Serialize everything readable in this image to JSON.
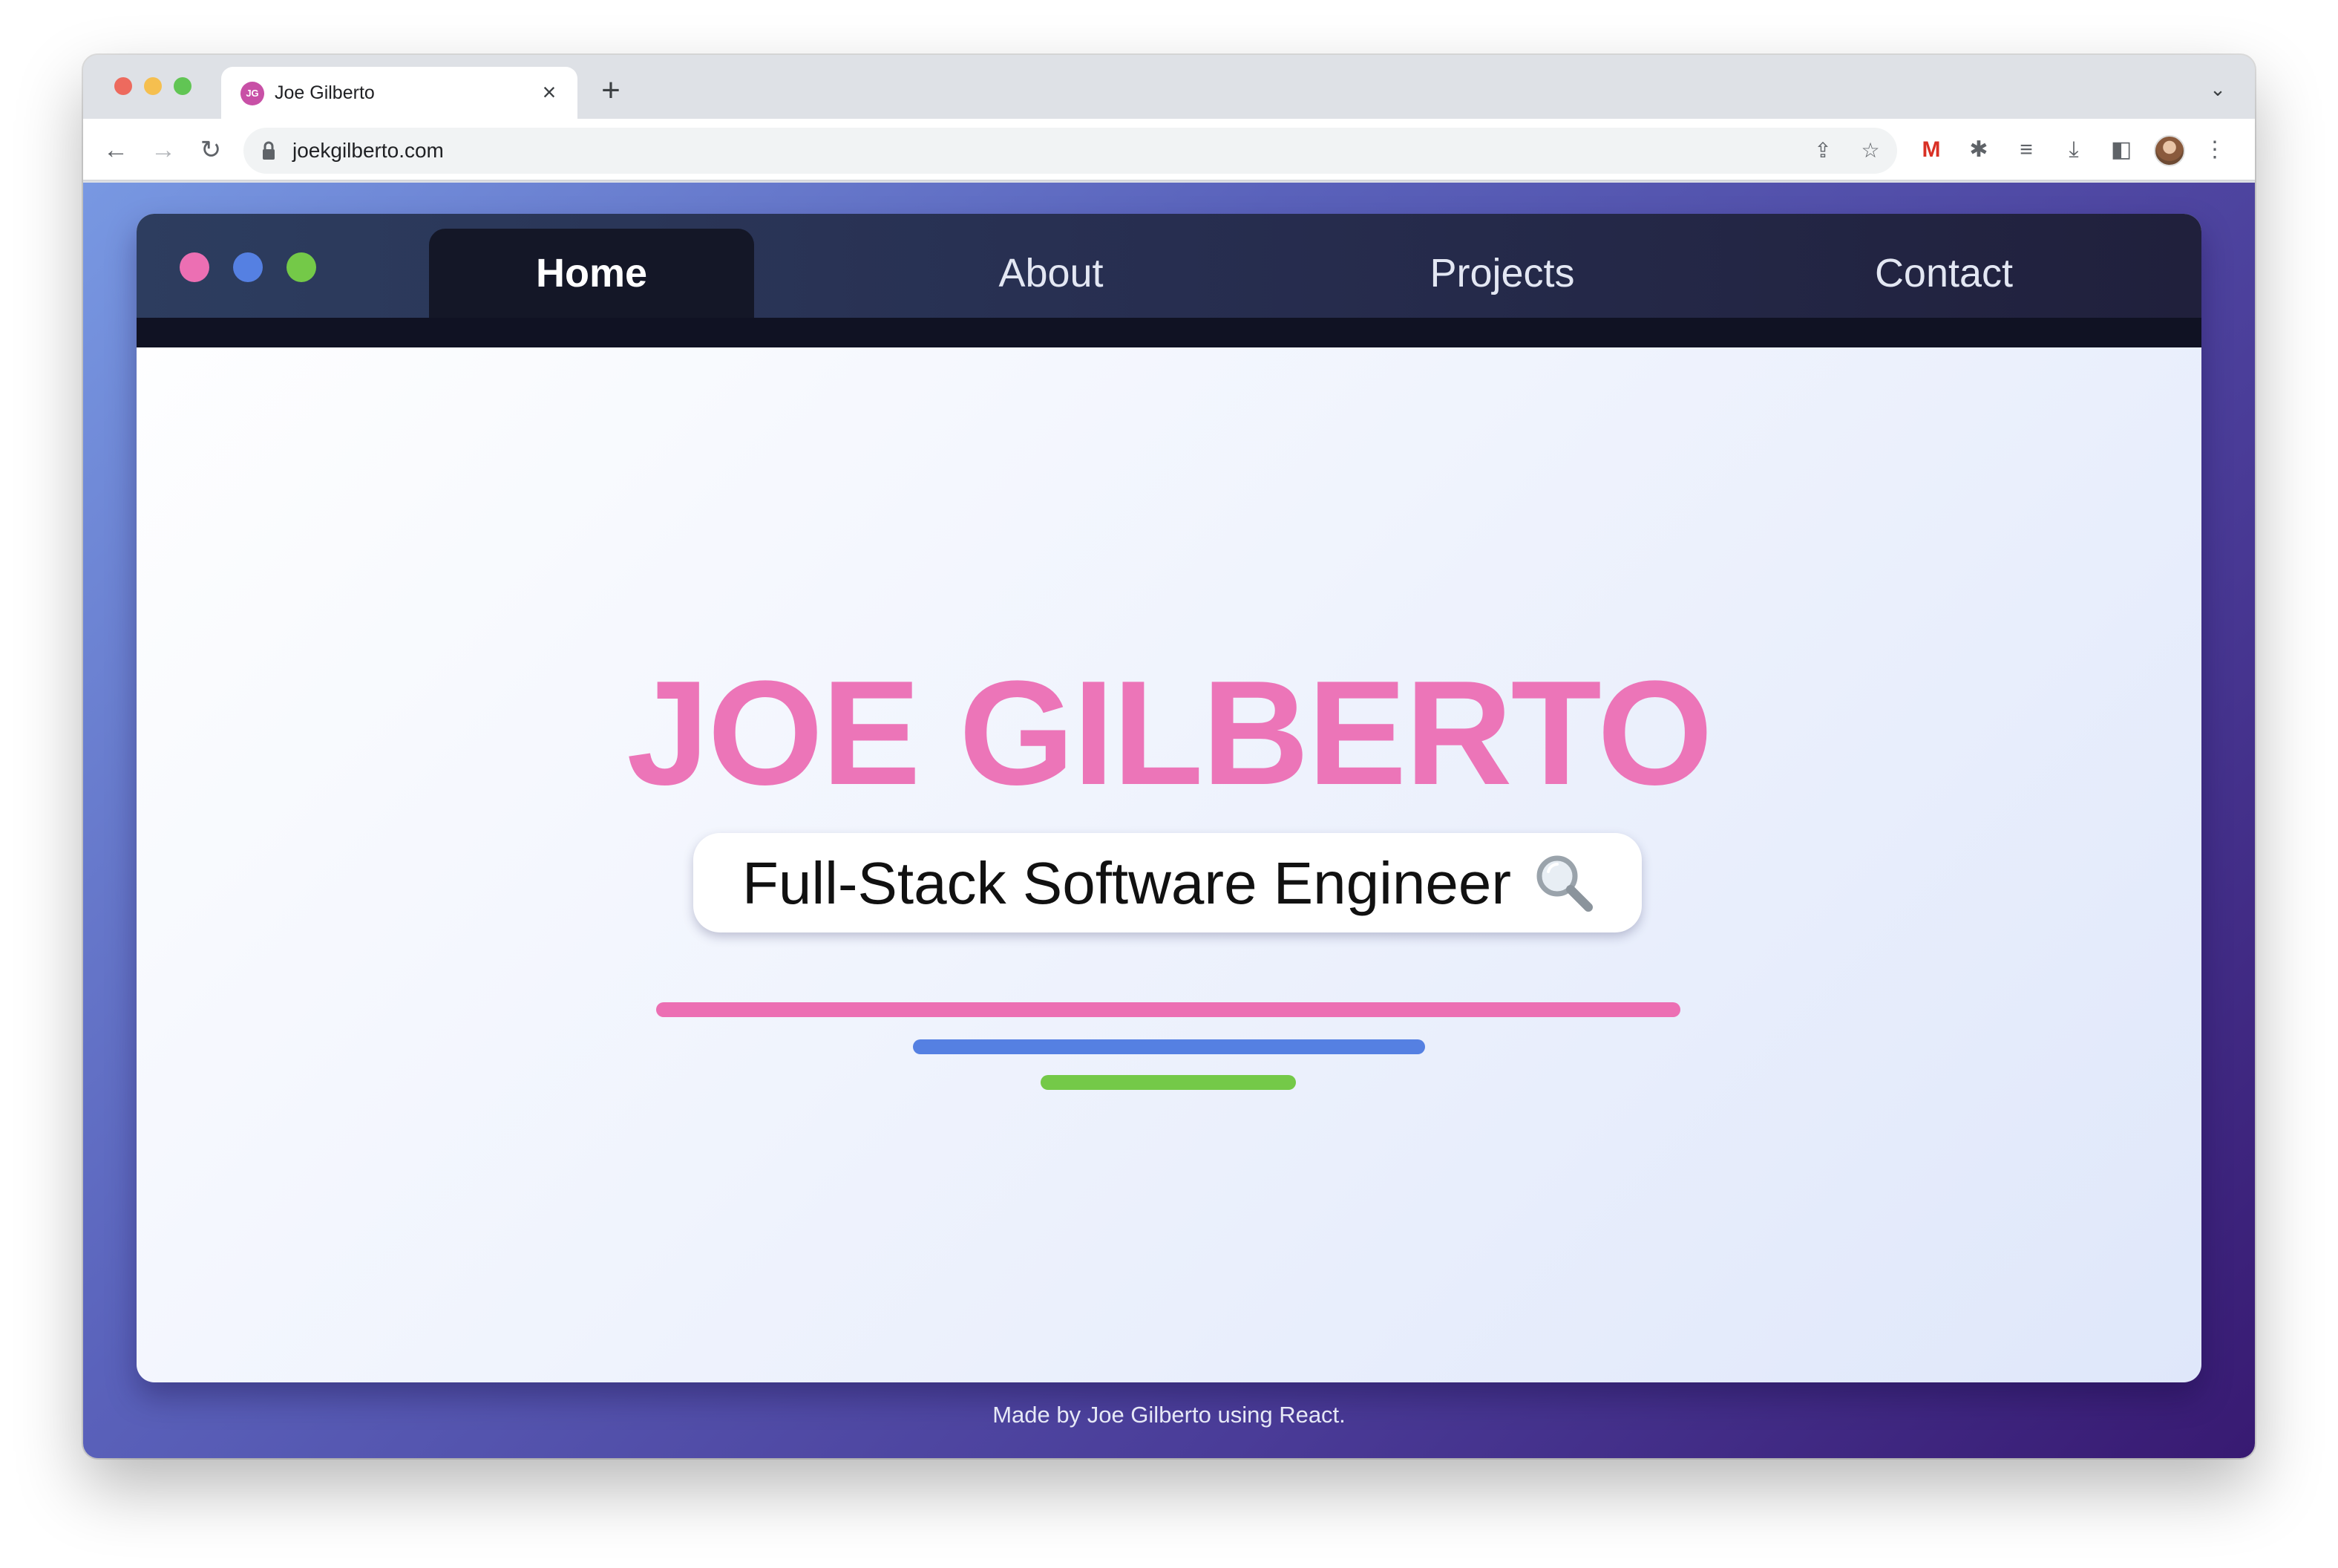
{
  "browser": {
    "tab": {
      "favicon_text": "JG",
      "title": "Joe Gilberto",
      "close_glyph": "×"
    },
    "new_tab_glyph": "+",
    "tab_menu_glyph": "⌄",
    "nav": {
      "back_glyph": "←",
      "forward_glyph": "→",
      "reload_glyph": "↻"
    },
    "url": "joekgilberto.com",
    "omnibox_icons": {
      "share_glyph": "⇪",
      "star_glyph": "☆"
    },
    "extensions": [
      {
        "name": "gmail-icon",
        "glyph": "M",
        "color": "#d93025"
      },
      {
        "name": "puzzle-icon",
        "glyph": "✱"
      },
      {
        "name": "media-icon",
        "glyph": "≡"
      },
      {
        "name": "download-icon",
        "glyph": "⤓"
      },
      {
        "name": "side-panel-icon",
        "glyph": "◧"
      }
    ],
    "menu_glyph": "⋮"
  },
  "site": {
    "nav_dots": {
      "pink": "#ec6fb3",
      "blue": "#5580e2",
      "green": "#74c948"
    },
    "nav_items": [
      {
        "label": "Home",
        "active": true
      },
      {
        "label": "About",
        "active": false
      },
      {
        "label": "Projects",
        "active": false
      },
      {
        "label": "Contact",
        "active": false
      }
    ],
    "hero": {
      "name": "JOE GILBERTO",
      "role": "Full-Stack Software Engineer",
      "name_color": "#ec75b8"
    },
    "footer": "Made by Joe Gilberto using React."
  },
  "colors": {
    "page_gradient": [
      "#7898e2",
      "#381a72"
    ],
    "navbar": "#272e50",
    "active_tab": "#141727"
  }
}
